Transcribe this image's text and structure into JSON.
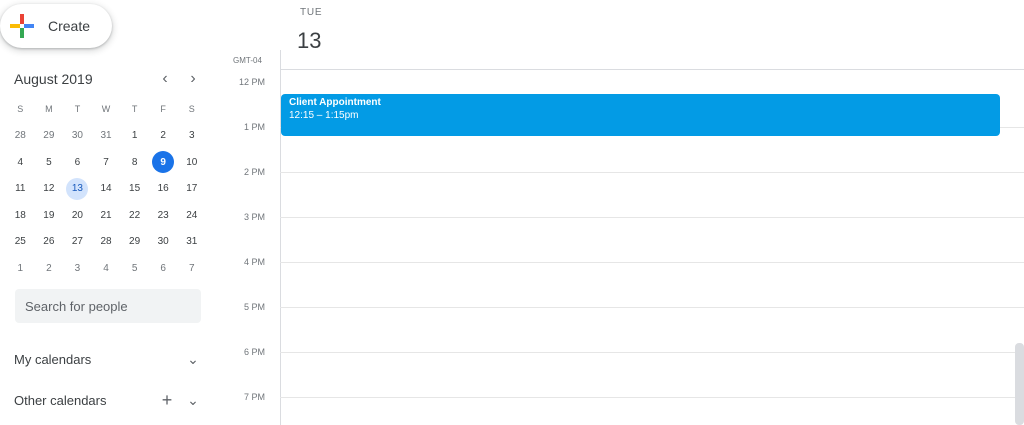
{
  "create_button": {
    "label": "Create"
  },
  "mini_calendar": {
    "month_label": "August 2019",
    "prev_icon": "chevron-left-icon",
    "next_icon": "chevron-right-icon",
    "weekdays": [
      "S",
      "M",
      "T",
      "W",
      "T",
      "F",
      "S"
    ],
    "weeks": [
      [
        {
          "d": "28",
          "m": true
        },
        {
          "d": "29",
          "m": true
        },
        {
          "d": "30",
          "m": true
        },
        {
          "d": "31",
          "m": true
        },
        {
          "d": "1"
        },
        {
          "d": "2"
        },
        {
          "d": "3"
        }
      ],
      [
        {
          "d": "4"
        },
        {
          "d": "5"
        },
        {
          "d": "6"
        },
        {
          "d": "7"
        },
        {
          "d": "8"
        },
        {
          "d": "9",
          "today": true
        },
        {
          "d": "10"
        }
      ],
      [
        {
          "d": "11"
        },
        {
          "d": "12"
        },
        {
          "d": "13",
          "selected": true
        },
        {
          "d": "14"
        },
        {
          "d": "15"
        },
        {
          "d": "16"
        },
        {
          "d": "17"
        }
      ],
      [
        {
          "d": "18"
        },
        {
          "d": "19"
        },
        {
          "d": "20"
        },
        {
          "d": "21"
        },
        {
          "d": "22"
        },
        {
          "d": "23"
        },
        {
          "d": "24"
        }
      ],
      [
        {
          "d": "25"
        },
        {
          "d": "26"
        },
        {
          "d": "27"
        },
        {
          "d": "28"
        },
        {
          "d": "29"
        },
        {
          "d": "30"
        },
        {
          "d": "31"
        }
      ],
      [
        {
          "d": "1",
          "m": true
        },
        {
          "d": "2",
          "m": true
        },
        {
          "d": "3",
          "m": true
        },
        {
          "d": "4",
          "m": true
        },
        {
          "d": "5",
          "m": true
        },
        {
          "d": "6",
          "m": true
        },
        {
          "d": "7",
          "m": true
        }
      ]
    ]
  },
  "search": {
    "placeholder": "Search for people"
  },
  "my_calendars": {
    "label": "My calendars"
  },
  "other_calendars": {
    "label": "Other calendars"
  },
  "day_view": {
    "weekday": "TUE",
    "day_number": "13",
    "timezone": "GMT-04",
    "hours": [
      "12 PM",
      "1 PM",
      "2 PM",
      "3 PM",
      "4 PM",
      "5 PM",
      "6 PM",
      "7 PM"
    ]
  },
  "event": {
    "title": "Client Appointment",
    "time": "12:15 – 1:15pm",
    "color": "#039be5"
  },
  "colors": {
    "accent": "#1a73e8",
    "selected_bg": "#d2e3fc"
  }
}
